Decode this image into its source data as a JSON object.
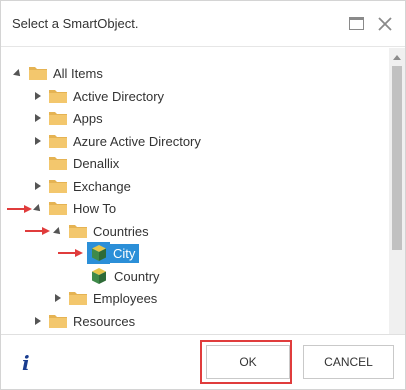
{
  "dialog": {
    "title": "Select a SmartObject.",
    "maximize_icon": "maximize-icon",
    "close_icon": "close-icon"
  },
  "tree": {
    "items": [
      {
        "label": "All Items",
        "expanded": true,
        "icon": "folder-icon"
      },
      {
        "label": "Active Directory",
        "expanded": false,
        "icon": "folder-icon"
      },
      {
        "label": "Apps",
        "expanded": false,
        "icon": "folder-icon"
      },
      {
        "label": "Azure Active Directory",
        "expanded": false,
        "icon": "folder-icon"
      },
      {
        "label": "Denallix",
        "icon": "folder-icon"
      },
      {
        "label": "Exchange",
        "expanded": false,
        "icon": "folder-icon"
      },
      {
        "label": "How To",
        "expanded": true,
        "icon": "folder-icon"
      },
      {
        "label": "Countries",
        "expanded": true,
        "icon": "folder-icon"
      },
      {
        "label": "City",
        "selected": true,
        "icon": "smartobject-icon"
      },
      {
        "label": "Country",
        "icon": "smartobject-icon"
      },
      {
        "label": "Employees",
        "expanded": false,
        "icon": "folder-icon"
      },
      {
        "label": "Resources",
        "expanded": false,
        "icon": "folder-icon"
      }
    ]
  },
  "footer": {
    "info_icon": "info-icon",
    "info_glyph": "i",
    "ok_label": "OK",
    "cancel_label": "CANCEL"
  },
  "colors": {
    "folder": "#f0c36b",
    "folder_tab": "#e5b353",
    "selection": "#2b8fd8",
    "annotation": "#e03c3c",
    "info": "#1a3d8f"
  }
}
